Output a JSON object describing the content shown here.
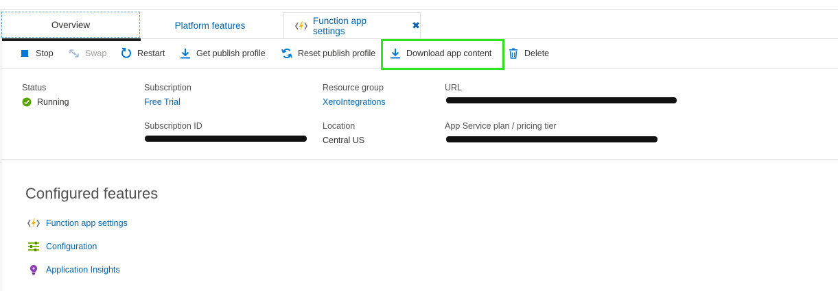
{
  "tabs": {
    "overview": "Overview",
    "platform_features": "Platform features",
    "function_app_settings": "Function app settings",
    "close_glyph": "✖"
  },
  "toolbar": {
    "stop": "Stop",
    "swap": "Swap",
    "restart": "Restart",
    "get_publish_profile": "Get publish profile",
    "reset_publish_profile": "Reset publish profile",
    "download_app_content": "Download app content",
    "delete": "Delete"
  },
  "essentials": {
    "status_label": "Status",
    "status_value": "Running",
    "subscription_label": "Subscription",
    "subscription_value": "Free Trial",
    "subscription_id_label": "Subscription ID",
    "resource_group_label": "Resource group",
    "resource_group_value": "XeroIntegrations",
    "location_label": "Location",
    "location_value": "Central US",
    "url_label": "URL",
    "plan_label": "App Service plan / pricing tier"
  },
  "configured_features": {
    "title": "Configured features",
    "items": [
      {
        "label": "Function app settings",
        "icon": "function-bolt-icon"
      },
      {
        "label": "Configuration",
        "icon": "configuration-icon"
      },
      {
        "label": "Application Insights",
        "icon": "app-insights-icon"
      }
    ]
  },
  "colors": {
    "link": "#0062ad",
    "highlight": "#2ee41e",
    "running": "#57a300",
    "bolt": "#f5b400"
  }
}
